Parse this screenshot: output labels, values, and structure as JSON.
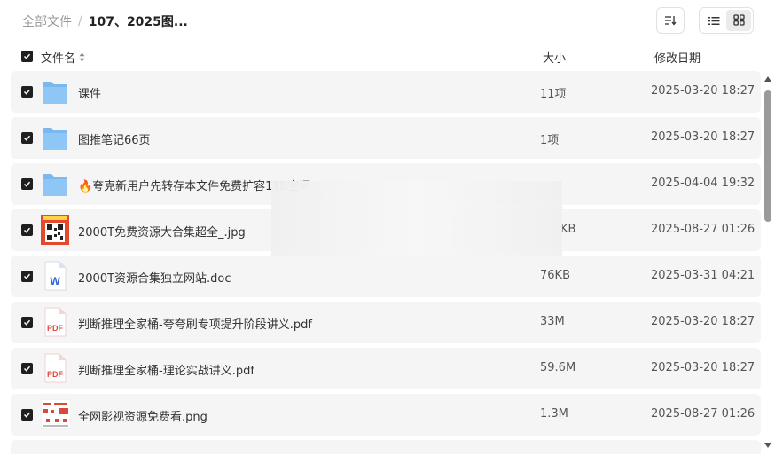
{
  "breadcrumb": {
    "root": "全部文件",
    "separator": "/",
    "current": "107、2025图..."
  },
  "header": {
    "name": "文件名",
    "size": "大小",
    "date": "修改日期"
  },
  "files": [
    {
      "name": "课件",
      "size": "11项",
      "date": "2025-03-20 18:27",
      "icon": "folder-icon"
    },
    {
      "name": "图推笔记66页",
      "size": "1项",
      "date": "2025-03-20 18:27",
      "icon": "folder-icon"
    },
    {
      "name": "🔥夸克新用户先转存本文件免费扩容1TB空间",
      "size": "",
      "date": "2025-04-04 19:32",
      "icon": "folder-icon"
    },
    {
      "name": "2000T免费资源大合集超全_.jpg",
      "size": "KB",
      "date": "2025-08-27 01:26",
      "icon": "image-thumbnail-icon"
    },
    {
      "name": "2000T资源合集独立网站.doc",
      "size": "76KB",
      "date": "2025-03-31 04:21",
      "icon": "word-doc-icon"
    },
    {
      "name": "判断推理全家桶-夸夸刷专项提升阶段讲义.pdf",
      "size": "33M",
      "date": "2025-03-20 18:27",
      "icon": "pdf-icon"
    },
    {
      "name": "判断推理全家桶-理论实战讲义.pdf",
      "size": "59.6M",
      "date": "2025-03-20 18:27",
      "icon": "pdf-icon"
    },
    {
      "name": "全网影视资源免费看.png",
      "size": "1.3M",
      "date": "2025-08-27 01:26",
      "icon": "image-thumbnail-icon"
    }
  ],
  "icon_labels": {
    "pdf": "PDF",
    "word": "W"
  },
  "colors": {
    "folder": "#7ab8f0",
    "pdf": "#e2473e",
    "word": "#2b64d3",
    "row_bg": "#f5f5f5",
    "checkbox": "#1f1f1f"
  }
}
